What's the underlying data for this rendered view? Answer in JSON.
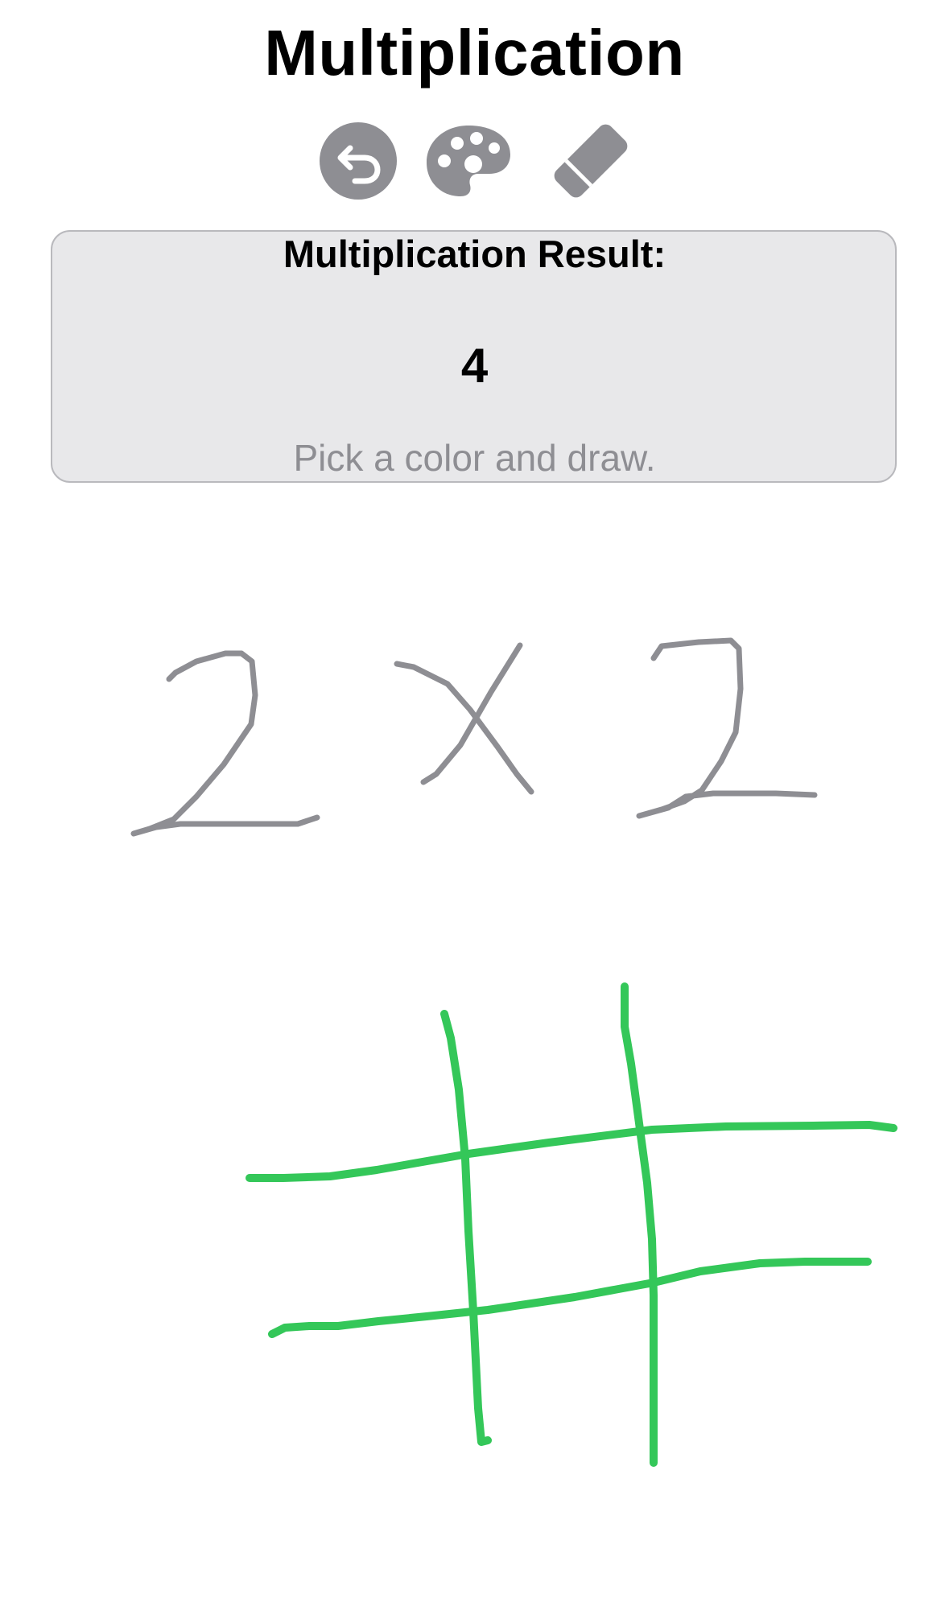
{
  "header": {
    "title": "Multiplication"
  },
  "toolbar": {
    "buttons": [
      {
        "name": "undo-button",
        "icon": "arrow-uturn-backward-circle-icon"
      },
      {
        "name": "palette-button",
        "icon": "palette-icon"
      },
      {
        "name": "eraser-button",
        "icon": "eraser-icon"
      }
    ],
    "icon_color": "#8e8e93"
  },
  "result": {
    "heading": "Multiplication Result:",
    "value": "4",
    "hint": "Pick a color and draw."
  },
  "canvas": {
    "strokes": [
      {
        "name": "handwritten-digit-2",
        "color": "#8e8e93"
      },
      {
        "name": "handwritten-multiply-sign",
        "color": "#8e8e93"
      },
      {
        "name": "handwritten-digit-2",
        "color": "#8e8e93"
      },
      {
        "name": "tic-tac-toe-grid",
        "color": "#34c759"
      }
    ]
  }
}
